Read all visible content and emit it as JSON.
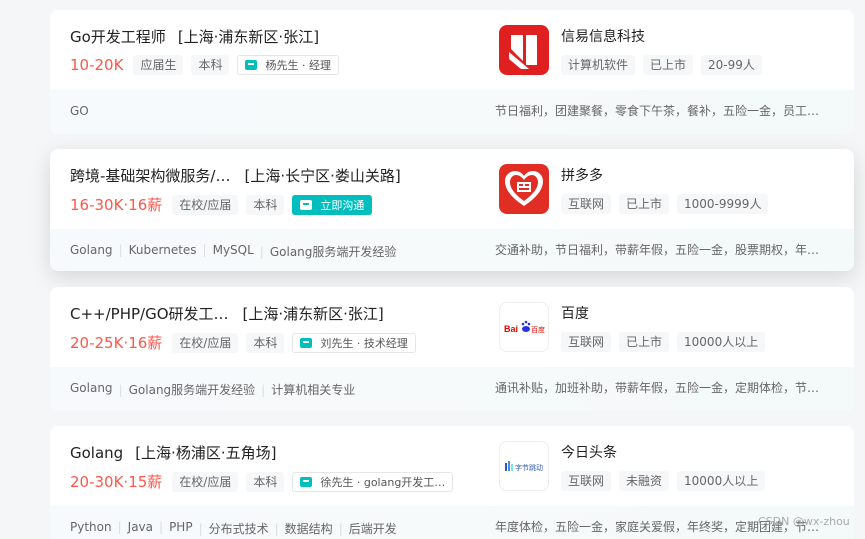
{
  "jobs": [
    {
      "title": "Go开发工程师",
      "area": "[上海·浦东新区·张江]",
      "salary": "10-20K",
      "tags": [
        "应届生",
        "本科"
      ],
      "boss": "杨先生 · 经理",
      "company": "信易信息科技",
      "company_tags": [
        "计算机软件",
        "已上市",
        "20-99人"
      ],
      "skills": [
        "GO"
      ],
      "welfare": "节日福利，团建聚餐，零食下午茶，餐补，五险一金，员工…"
    },
    {
      "title": "跨境-基础架构微服务/…",
      "area": "[上海·长宁区·娄山关路]",
      "salary": "16-30K·16薪",
      "tags": [
        "在校/应届",
        "本科"
      ],
      "chat_label": "立即沟通",
      "company": "拼多多",
      "company_tags": [
        "互联网",
        "已上市",
        "1000-9999人"
      ],
      "skills": [
        "Golang",
        "Kubernetes",
        "MySQL",
        "Golang服务端开发经验"
      ],
      "welfare": "交通补助，节日福利，带薪年假，五险一金，股票期权，年…"
    },
    {
      "title": "C++/PHP/GO研发工…",
      "area": "[上海·浦东新区·张江]",
      "salary": "20-25K·16薪",
      "tags": [
        "在校/应届",
        "本科"
      ],
      "boss": "刘先生 · 技术经理",
      "company": "百度",
      "company_tags": [
        "互联网",
        "已上市",
        "10000人以上"
      ],
      "skills": [
        "Golang",
        "Golang服务端开发经验",
        "计算机相关专业"
      ],
      "welfare": "通讯补贴，加班补助，带薪年假，五险一金，定期体检，节…"
    },
    {
      "title": "Golang",
      "area": "[上海·杨浦区·五角场]",
      "salary": "20-30K·15薪",
      "tags": [
        "在校/应届",
        "本科"
      ],
      "boss": "徐先生 · golang开发工…",
      "company": "今日头条",
      "company_tags": [
        "互联网",
        "未融资",
        "10000人以上"
      ],
      "skills": [
        "Python",
        "Java",
        "PHP",
        "分布式技术",
        "数据结构",
        "后端开发"
      ],
      "welfare": "年度体检，五险一金，家庭关爱假，年终奖，定期团建，节…"
    }
  ],
  "logos": {
    "baidu": "Bai度百度",
    "toutiao": "字节跳动"
  },
  "watermark": "CSDN @wx-zhou",
  "colors": {
    "salary": "#fe574a",
    "accent": "#00bebd",
    "xinyi_red": "#e02020",
    "pdd_red": "#e02e24",
    "baidu_blue": "#2932e1"
  }
}
